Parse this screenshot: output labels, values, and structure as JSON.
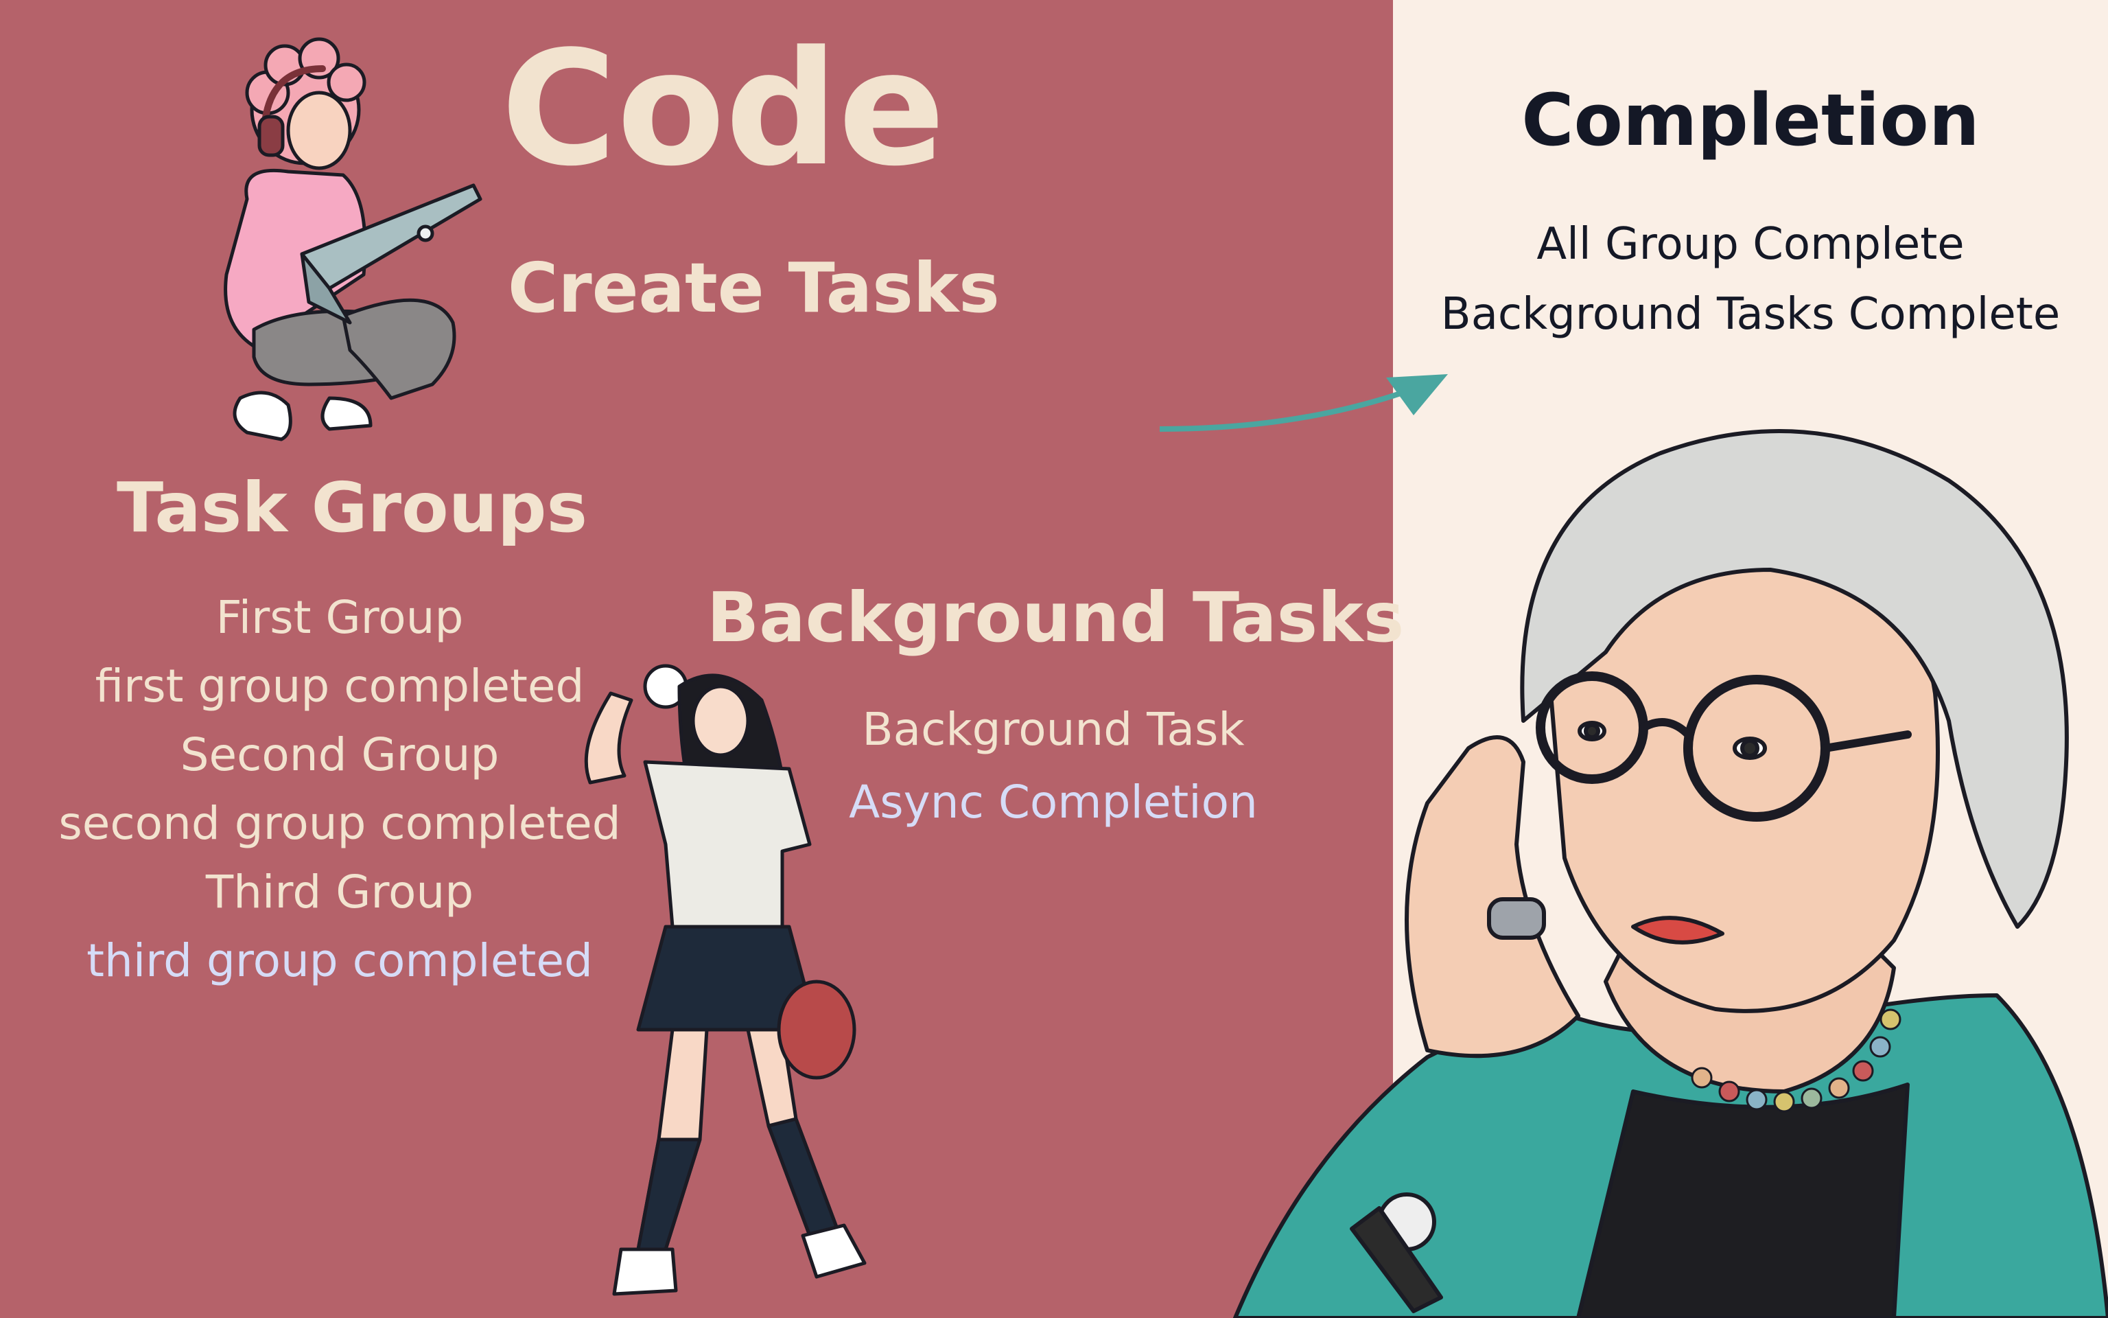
{
  "code_panel": {
    "title": "Code",
    "subtitle": "Create Tasks",
    "task_groups": {
      "heading": "Task Groups",
      "lines": [
        "First Group",
        "first group completed",
        "Second Group",
        "second group completed",
        "Third Group",
        "third group completed"
      ]
    },
    "background_tasks": {
      "heading": "Background Tasks",
      "lines": [
        "Background Task",
        "Async Completion"
      ]
    }
  },
  "completion_panel": {
    "title": "Completion",
    "lines": [
      "All Group Complete",
      "Background Tasks Complete"
    ]
  },
  "colors": {
    "left_background": "#b5626a",
    "right_background": "#faefe6",
    "cream_text": "#f2e3cf",
    "lavender_text": "#d6dcf7",
    "arrow": "#4aa6a0"
  },
  "illustrations": {
    "coder": "person-with-laptop-icon",
    "player": "girl-with-baseball-glove-icon",
    "thinker": "old-woman-thinking-icon"
  }
}
